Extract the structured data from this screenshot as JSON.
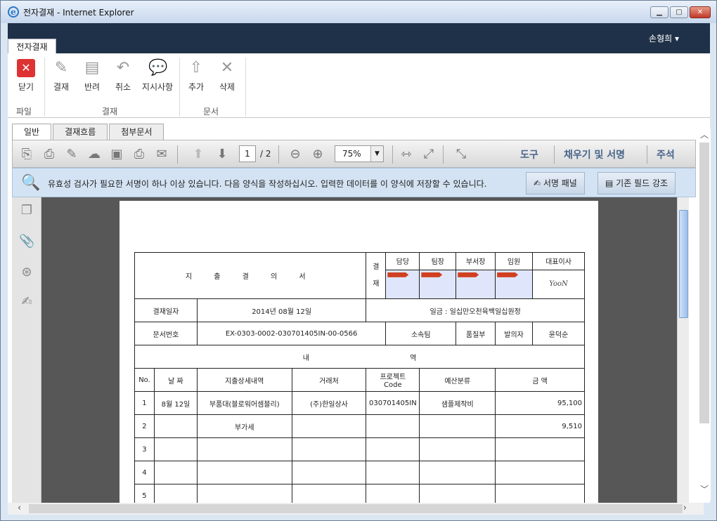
{
  "window": {
    "title": "전자결재 - Internet Explorer",
    "min": "▁",
    "max": "▢",
    "close": "✕"
  },
  "header": {
    "user": "손형희 ▾",
    "app_tab": "전자결재"
  },
  "ribbon": {
    "buttons": [
      {
        "label": "닫기"
      },
      {
        "label": "결재"
      },
      {
        "label": "반려"
      },
      {
        "label": "취소"
      },
      {
        "label": "지시사항"
      },
      {
        "label": "추가"
      },
      {
        "label": "삭제"
      }
    ],
    "groups": [
      "파일",
      "결재",
      "문서"
    ]
  },
  "tabs": [
    "일반",
    "결재흐름",
    "첨부문서"
  ],
  "toolbar": {
    "page": "1",
    "total": "/ 2",
    "zoom": "75%",
    "tools": "도구",
    "fill_sign": "채우기 및 서명",
    "comment": "주석"
  },
  "notice": {
    "text": "유효성 검사가 필요한 서명이 하나 이상 있습니다. 다음 양식을 작성하십시오. 입력한 데이터를 이 양식에 저장할 수 있습니다.",
    "sign_panel": "서명 패널",
    "highlight": "기존 필드 강조"
  },
  "form": {
    "title": "지 출 결 의 서",
    "approval_label": "결\n재",
    "approvers": [
      "담당",
      "팀장",
      "부서장",
      "임원",
      "대표이사"
    ],
    "signature": "YooN",
    "date_label": "결재일자",
    "date_value": "2014년  08월  12일",
    "amount_text": "일금 : 일십만오천육백일십원정",
    "docno_label": "문서번호",
    "docno_value": "EX-0303-0002-030701405IN-00-0566",
    "dept_label": "소속팀",
    "dept_value": "품질부",
    "drafter_label": "발의자",
    "drafter_value": "윤덕순",
    "detail_header_l": "내",
    "detail_header_r": "역",
    "cols": [
      "No.",
      "날 짜",
      "지출상세내역",
      "거래처",
      "프로젝트\nCode",
      "예산분류",
      "금   액"
    ],
    "rows": [
      [
        "1",
        "8월  12일",
        "부품대(블로워어셈블리)",
        "(주)한일상사",
        "030701405IN",
        "샘플제작비",
        "95,100"
      ],
      [
        "2",
        "",
        "부가세",
        "",
        "",
        "",
        "9,510"
      ],
      [
        "3",
        "",
        "",
        "",
        "",
        "",
        ""
      ],
      [
        "4",
        "",
        "",
        "",
        "",
        "",
        ""
      ],
      [
        "5",
        "",
        "",
        "",
        "",
        "",
        ""
      ]
    ]
  }
}
